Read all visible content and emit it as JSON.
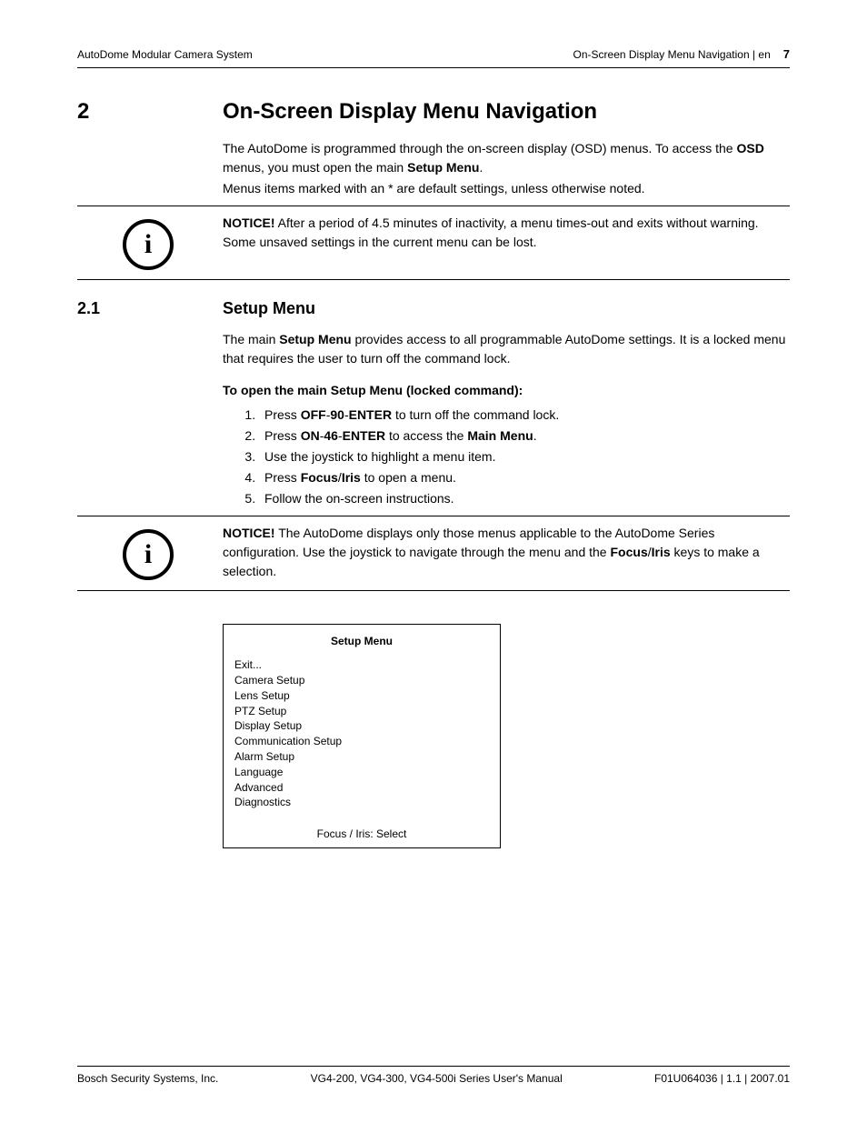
{
  "header": {
    "left": "AutoDome Modular Camera System",
    "right": "On-Screen Display Menu Navigation | en",
    "page": "7"
  },
  "chapter": {
    "num": "2",
    "title": "On-Screen Display Menu Navigation",
    "intro_seg1": "The AutoDome is programmed through the on-screen display (OSD) menus. To access the ",
    "intro_bold1": "OSD",
    "intro_seg2": " menus, you must open the main ",
    "intro_bold2": "Setup Menu",
    "intro_seg3": ".",
    "intro2": "Menus items marked with an * are default settings, unless otherwise noted."
  },
  "notice1": {
    "label": "NOTICE!",
    "text": " After a period of 4.5 minutes of inactivity, a menu times-out and exits without warning. Some unsaved settings in the current menu can be lost."
  },
  "section21": {
    "num": "2.1",
    "title": "Setup Menu",
    "p1a": "The main ",
    "p1b": "Setup Menu",
    "p1c": " provides access to all programmable AutoDome settings. It is a locked menu that requires the user to turn off the command lock.",
    "open_label": "To open the main Setup Menu (locked command):",
    "steps": {
      "s1a": "Press ",
      "s1b": "OFF",
      "s1c": "-",
      "s1d": "90",
      "s1e": "-",
      "s1f": "ENTER",
      "s1g": " to turn off the command lock.",
      "s2a": "Press ",
      "s2b": "ON",
      "s2c": "-",
      "s2d": "46",
      "s2e": "-",
      "s2f": "ENTER",
      "s2g": " to access the ",
      "s2h": "Main Menu",
      "s2i": ".",
      "s3": "Use the joystick to highlight a menu item.",
      "s4a": "Press ",
      "s4b": "Focus",
      "s4c": "/",
      "s4d": "Iris",
      "s4e": " to open a menu.",
      "s5": "Follow the on-screen instructions."
    }
  },
  "notice2": {
    "label": "NOTICE!",
    "t1": " The AutoDome displays only those menus applicable to the AutoDome Series configuration. Use the joystick to navigate through the menu and the ",
    "b1": "Focus",
    "t2": "/",
    "b2": "Iris",
    "t3": " keys to make a selection."
  },
  "menu": {
    "title": "Setup Menu",
    "items": [
      "Exit...",
      "Camera Setup",
      "Lens Setup",
      "PTZ Setup",
      "Display Setup",
      "Communication Setup",
      "Alarm Setup",
      "Language",
      "Advanced",
      "Diagnostics"
    ],
    "footer": "Focus / Iris: Select"
  },
  "footer": {
    "left": "Bosch Security Systems, Inc.",
    "center": "VG4-200, VG4-300, VG4-500i Series User's Manual",
    "right": "F01U064036 | 1.1 | 2007.01"
  },
  "icon_glyph": "i"
}
